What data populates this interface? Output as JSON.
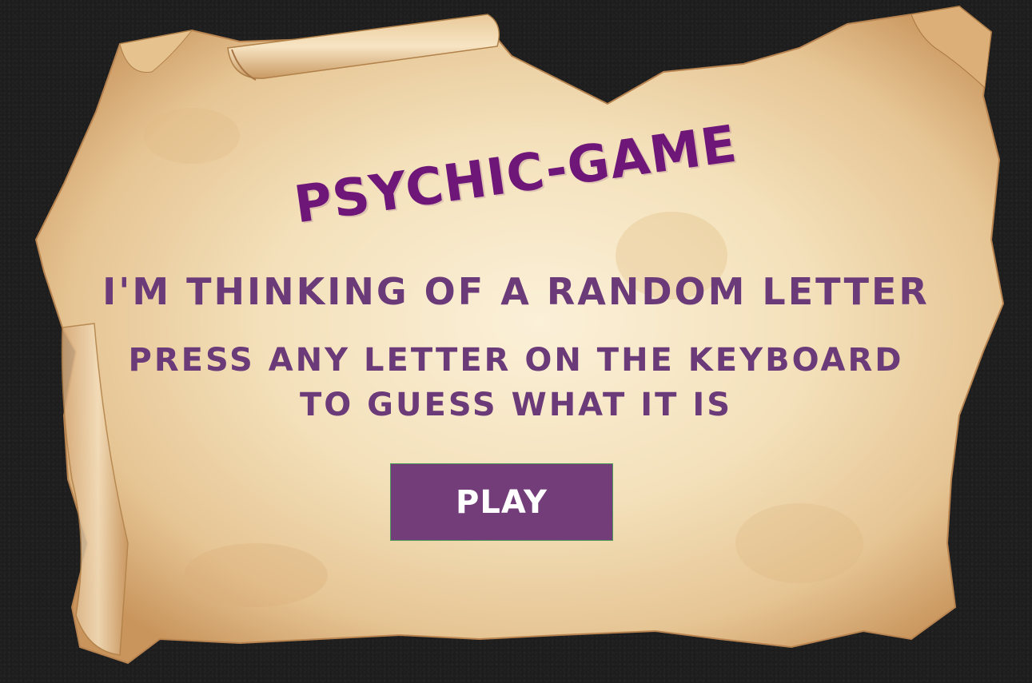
{
  "game": {
    "title": "PSYCHIC-GAME",
    "subtitle": "I'M THINKING OF A RANDOM LETTER",
    "instructions": {
      "line1": "PRESS ANY LETTER ON THE KEYBOARD",
      "line2": "TO GUESS WHAT IT IS"
    },
    "play_label": "PLAY"
  },
  "colors": {
    "background": "#1d1d1d",
    "parchment": "#f3dfb8",
    "title": "#6e1779",
    "text": "#6b3a78",
    "button": "#733d79",
    "button_text": "#ffffff"
  }
}
